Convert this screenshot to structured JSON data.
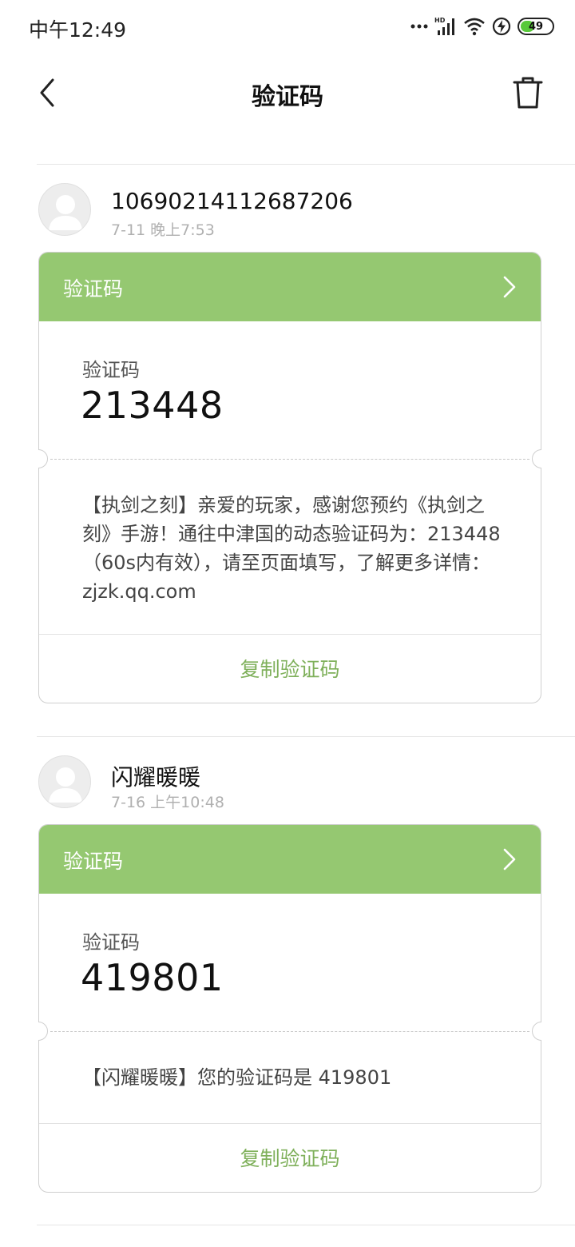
{
  "status_bar": {
    "time": "中午12:49",
    "battery": "49",
    "battery_level": 0.49,
    "icons": [
      "more-dots-icon",
      "hd-signal-icon",
      "wifi-icon",
      "charging-icon",
      "battery-icon"
    ]
  },
  "header": {
    "title": "验证码",
    "back_icon": "back-arrow-icon",
    "delete_icon": "trash-icon"
  },
  "messages": [
    {
      "sender": "10690214112687206",
      "time": "7-11 晚上7:53",
      "card_title": "验证码",
      "code_label": "验证码",
      "code": "213448",
      "body": "【执剑之刻】亲爱的玩家，感谢您预约《执剑之刻》手游！通往中津国的动态验证码为：213448（60s内有效），请至页面填写，了解更多详情：zjzk.qq.com",
      "copy_label": "复制验证码"
    },
    {
      "sender": "闪耀暖暖",
      "time": "7-16 上午10:48",
      "card_title": "验证码",
      "code_label": "验证码",
      "code": "419801",
      "body": "【闪耀暖暖】您的验证码是 419801",
      "copy_label": "复制验证码"
    }
  ],
  "colors": {
    "card_header": "#95c871",
    "accent_text": "#7fb05b",
    "timestamp": "#b0b0b0"
  }
}
